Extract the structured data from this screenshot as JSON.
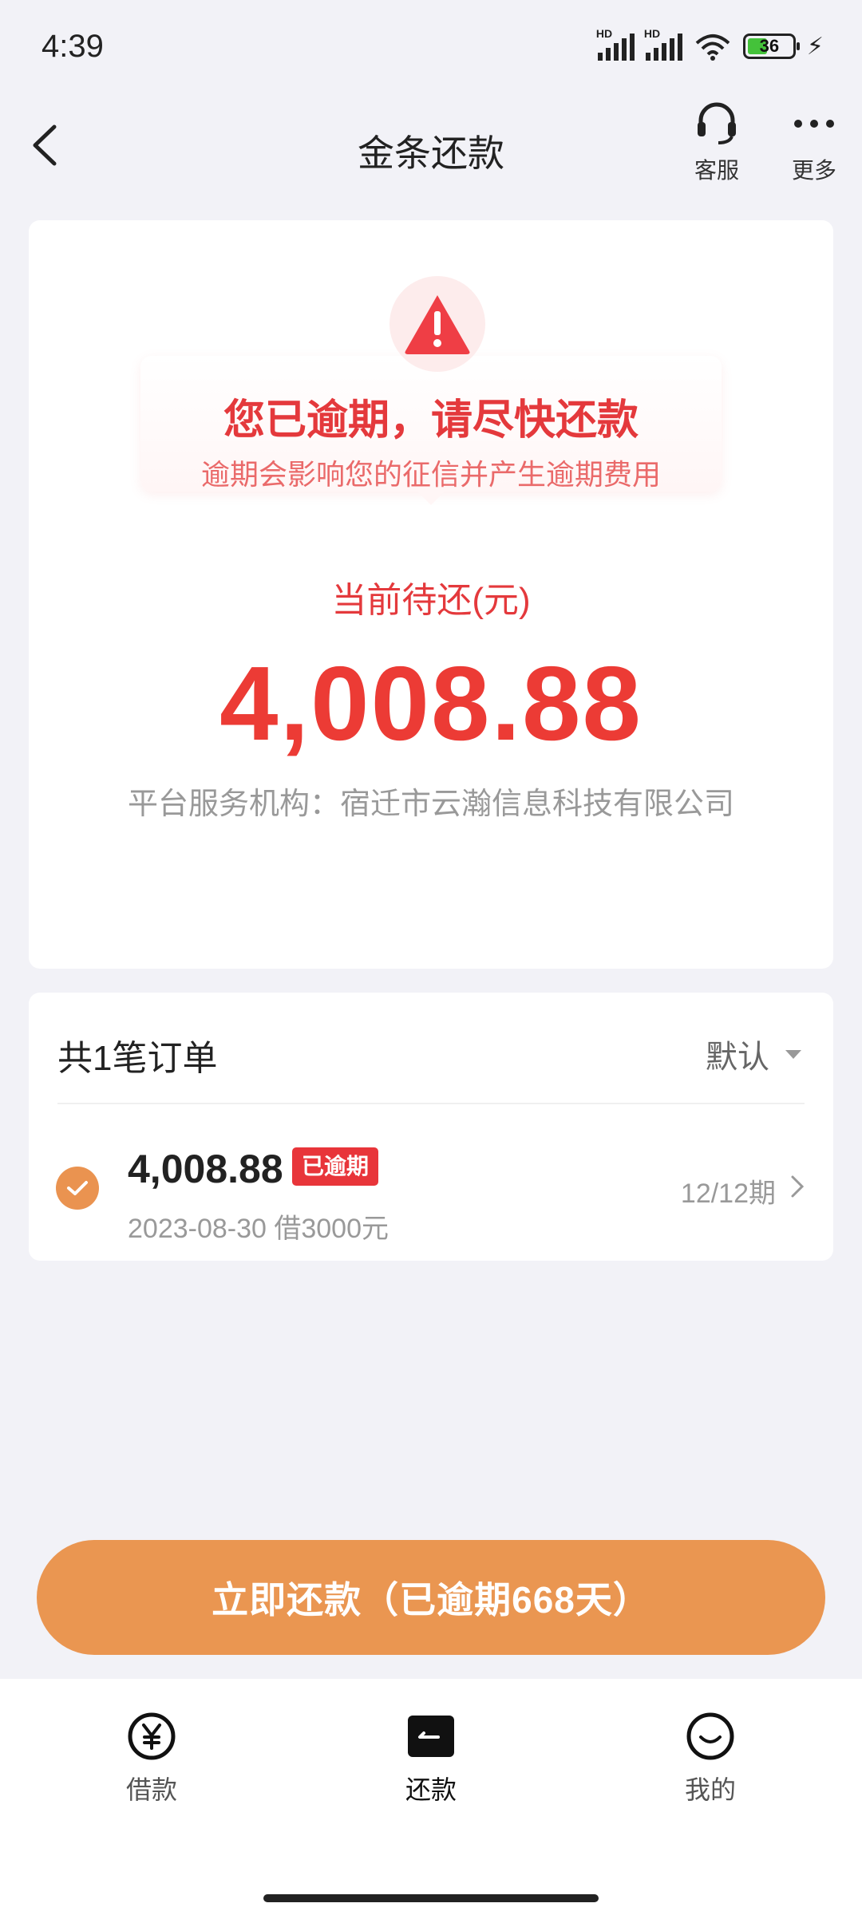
{
  "status_bar": {
    "time": "4:39",
    "hd1": "HD",
    "hd2": "HD",
    "battery": "36"
  },
  "header": {
    "title": "金条还款",
    "service_label": "客服",
    "more_label": "更多"
  },
  "main_card": {
    "warning_title": "您已逾期，请尽快还款",
    "warning_subtitle": "逾期会影响您的征信并产生逾期费用",
    "due_label": "当前待还(元)",
    "due_amount": "4,008.88",
    "provider": "平台服务机构：宿迁市云瀚信息科技有限公司"
  },
  "orders": {
    "title": "共1笔订单",
    "sort_label": "默认",
    "items": [
      {
        "amount": "4,008.88",
        "badge": "已逾期",
        "meta": "2023-08-30 借3000元",
        "period": "12/12期"
      }
    ]
  },
  "repay_button": {
    "label": "立即还款（已逾期668天）"
  },
  "tabbar": {
    "tabs": [
      {
        "label": "借款",
        "icon": "yuan-icon"
      },
      {
        "label": "还款",
        "icon": "repay-icon"
      },
      {
        "label": "我的",
        "icon": "smile-icon"
      }
    ]
  },
  "colors": {
    "accent": "#ea9651",
    "danger": "#e4393c",
    "background": "#f2f2f7"
  }
}
